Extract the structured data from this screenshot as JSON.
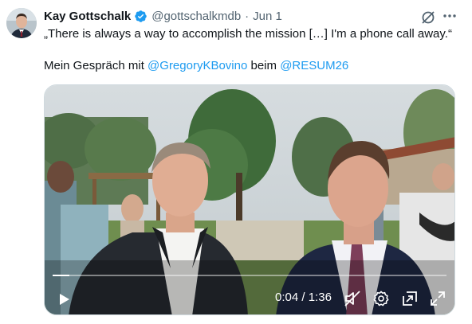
{
  "tweet": {
    "author_name": "Kay Gottschalk",
    "handle": "@gottschalkmdb",
    "separator": "·",
    "date": "Jun 1",
    "line1": "„There is always a way to accomplish the mission […] I'm a phone call away.“",
    "line2_prefix": "Mein Gespräch mit ",
    "mention1": "@GregoryKBovino",
    "line2_middle": " beim ",
    "mention2": "@RESUM26"
  },
  "video": {
    "current_time": "0:04",
    "duration": "1:36",
    "time_separator": " / ",
    "progress_fraction": 0.042
  },
  "icons": {
    "verified": "verified-badge-icon",
    "grok": "grok-icon",
    "more": "more-icon",
    "play": "play-icon",
    "mute": "mute-icon",
    "settings": "settings-icon",
    "pip": "picture-in-picture-icon",
    "fullscreen": "fullscreen-icon"
  },
  "colors": {
    "link": "#1d9bf0",
    "secondary_text": "#536471",
    "verified": "#1d9bf0"
  }
}
